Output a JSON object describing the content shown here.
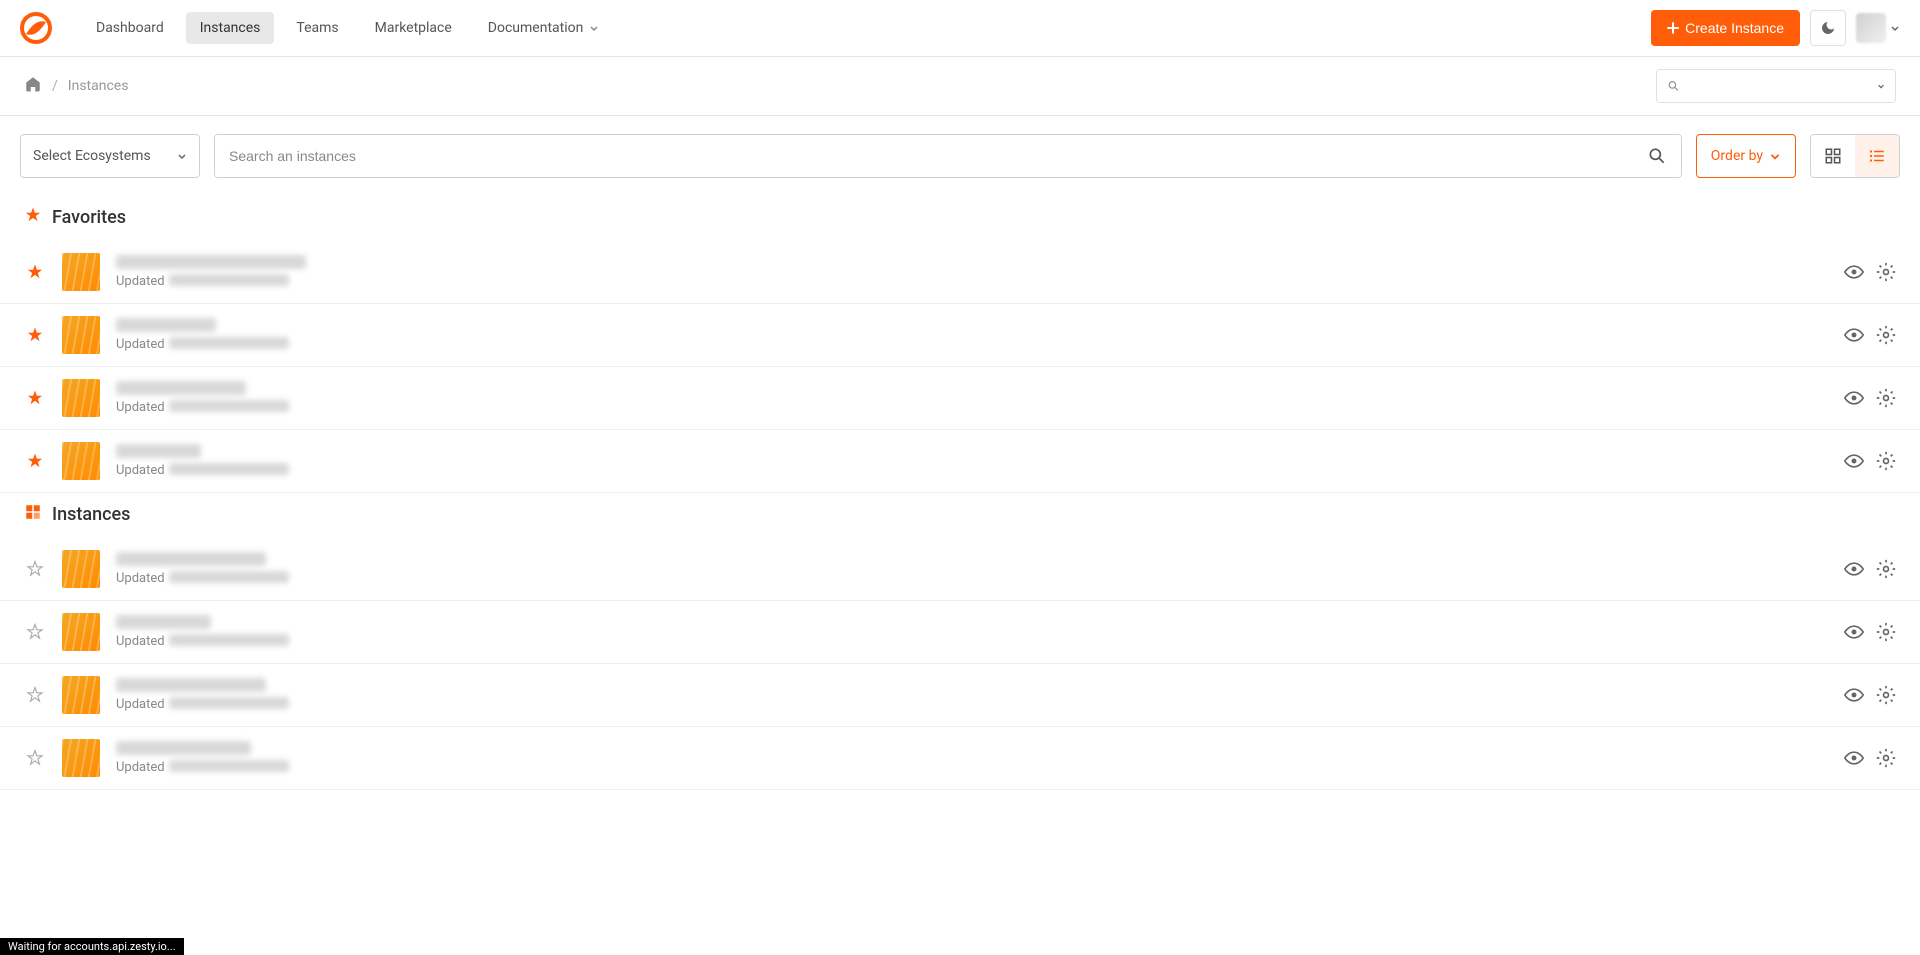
{
  "nav": {
    "items": [
      {
        "label": "Dashboard",
        "active": false
      },
      {
        "label": "Instances",
        "active": true
      },
      {
        "label": "Teams",
        "active": false
      },
      {
        "label": "Marketplace",
        "active": false
      },
      {
        "label": "Documentation",
        "active": false,
        "dropdown": true
      }
    ],
    "create_label": "Create Instance"
  },
  "breadcrumb": {
    "current": "Instances"
  },
  "controls": {
    "ecosystem_label": "Select Ecosystems",
    "search_placeholder": "Search an instances",
    "order_by_label": "Order by"
  },
  "sections": {
    "favorites_title": "Favorites",
    "instances_title": "Instances"
  },
  "favorites": [
    {
      "title_width": 190,
      "updated_label": "Updated",
      "date_width": 120
    },
    {
      "title_width": 100,
      "updated_label": "Updated",
      "date_width": 120
    },
    {
      "title_width": 130,
      "updated_label": "Updated",
      "date_width": 120
    },
    {
      "title_width": 85,
      "updated_label": "Updated",
      "date_width": 120
    }
  ],
  "instances": [
    {
      "title_width": 150,
      "updated_label": "Updated",
      "date_width": 120
    },
    {
      "title_width": 95,
      "updated_label": "Updated",
      "date_width": 120
    },
    {
      "title_width": 150,
      "updated_label": "Updated",
      "date_width": 120
    },
    {
      "title_width": 135,
      "updated_label": "Updated",
      "date_width": 120
    }
  ],
  "status": "Waiting for accounts.api.zesty.io..."
}
